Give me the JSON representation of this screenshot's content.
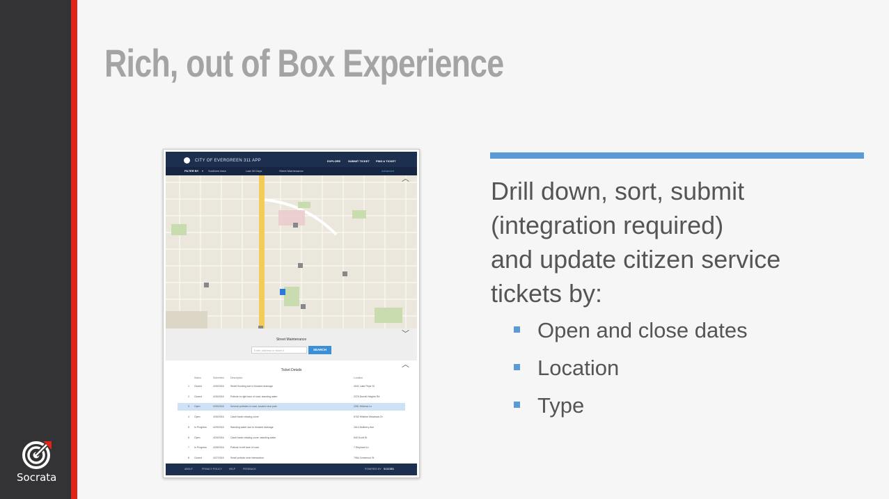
{
  "slide": {
    "title": "Rich, out of Box Experience",
    "body_lines": [
      "Drill down, sort, submit",
      "(integration required)",
      "and update citizen service",
      "tickets by:"
    ],
    "bullets": [
      "Open and close dates",
      "Location",
      "Type"
    ],
    "brand": "Socrata"
  },
  "colors": {
    "sidebar": "#333335",
    "accent_red": "#e2231a",
    "accent_blue": "#5b9bd5",
    "title_gray": "#a4a4a4",
    "app_navy": "#1c2f4e"
  },
  "app": {
    "title": "CITY OF EVERGREEN 311 APP",
    "nav": [
      "EXPLORE",
      "SUBMIT TICKET",
      "FIND A TICKET"
    ],
    "filter_label": "FILTER BY",
    "filters": [
      "Southern Area",
      "Last 30 Days",
      "Street Maintenance"
    ],
    "advanced_link": "Advanced",
    "street_panel_title": "Street Maintenance",
    "search_placeholder": "Enter address or ticket #",
    "search_button": "SEARCH",
    "ticket_panel_title": "Ticket Details",
    "columns": [
      "Status",
      "Submitted",
      "Description",
      "Location"
    ],
    "tickets": [
      {
        "num": "1",
        "status": "Closed",
        "date": "4/30/2016",
        "desc": "Street flooding due to blocked drainage",
        "loc": "4041 Lake Pepe St"
      },
      {
        "num": "2",
        "status": "Closed",
        "date": "4/30/2016",
        "desc": "Pothole in right lane of road, standing water",
        "loc": "2376 Durrell Heights Rd"
      },
      {
        "num": "3",
        "status": "Open",
        "date": "4/30/2016",
        "desc": "Several potholes in road, located near park",
        "loc": "2261 Hillcrest Ln"
      },
      {
        "num": "4",
        "status": "Open",
        "date": "4/30/2016",
        "desc": "Catch basin missing cover",
        "loc": "6762 Hillshire Meadows Dr"
      },
      {
        "num": "5",
        "status": "In Progress",
        "date": "4/29/2016",
        "desc": "Standing water due to blocked drainage",
        "loc": "1614 Mulberry Ave"
      },
      {
        "num": "6",
        "status": "Open",
        "date": "4/29/2016",
        "desc": "Catch basin missing cover, standing water",
        "loc": "540 Scott St"
      },
      {
        "num": "7",
        "status": "In Progress",
        "date": "4/28/2016",
        "desc": "Pothole in left lane of road",
        "loc": "7 Elephant Ln"
      },
      {
        "num": "8",
        "status": "Closed",
        "date": "4/27/2016",
        "desc": "Small pothole near intersection",
        "loc": "7984 Crestmoor St"
      }
    ],
    "footer_links": [
      "ABOUT",
      "PRIVACY POLICY",
      "HELP",
      "FEEDBACK"
    ],
    "powered_by": "POWERED BY",
    "powered_brand": "socrata"
  }
}
